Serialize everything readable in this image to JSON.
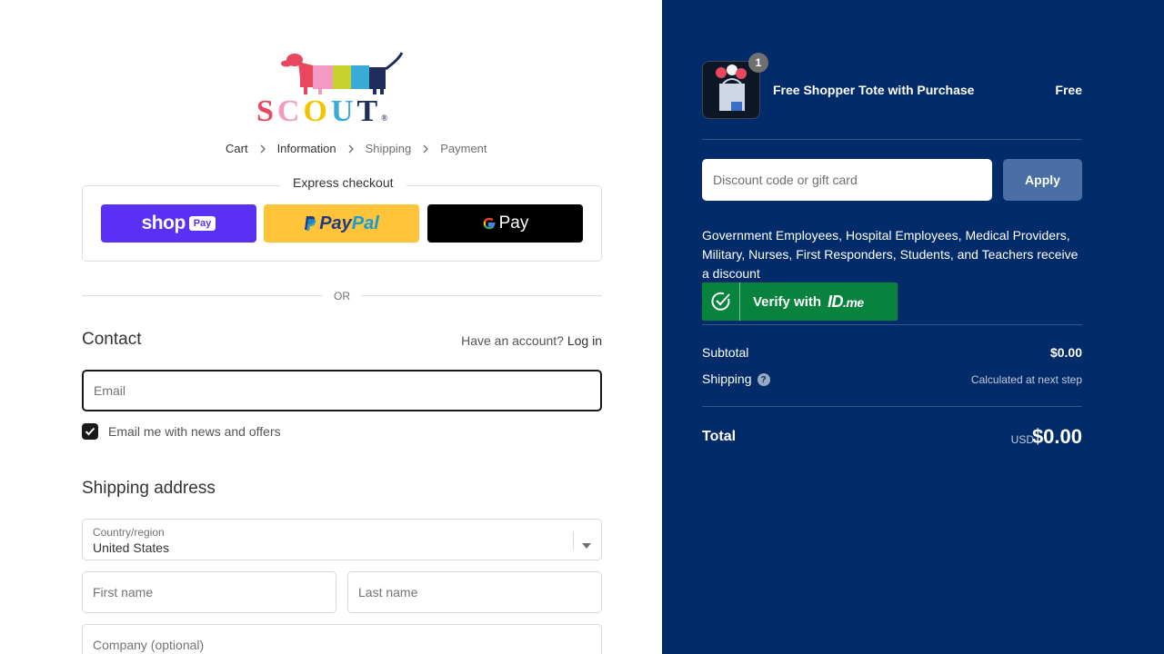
{
  "brand": {
    "logo_text": "SCOUT",
    "logo_colors": [
      "#e8475f",
      "#f49ac1",
      "#f5c400",
      "#3aaad6",
      "#1f2d5c"
    ],
    "logo_mark": "®"
  },
  "breadcrumb": {
    "items": [
      {
        "label": "Cart",
        "state": "link"
      },
      {
        "label": "Information",
        "state": "active"
      },
      {
        "label": "Shipping",
        "state": "inactive"
      },
      {
        "label": "Payment",
        "state": "inactive"
      }
    ]
  },
  "express_checkout": {
    "title": "Express checkout",
    "shop_pay": {
      "label_shop": "shop",
      "label_pay": "Pay",
      "color": "#5a31f4"
    },
    "paypal": {
      "label_pay": "Pay",
      "label_pal": "Pal",
      "color": "#ffc439"
    },
    "gpay": {
      "label": "Pay",
      "color": "#000000"
    }
  },
  "divider_or": "OR",
  "contact": {
    "title": "Contact",
    "have_account": "Have an account?",
    "login_link": "Log in",
    "email_placeholder": "Email",
    "email_value": "",
    "newsletter_label": "Email me with news and offers",
    "newsletter_checked": true
  },
  "shipping_address": {
    "title": "Shipping address",
    "country_label": "Country/region",
    "country_value": "United States",
    "first_name_placeholder": "First name",
    "last_name_placeholder": "Last name",
    "company_placeholder": "Company (optional)"
  },
  "summary": {
    "background": "#022b6a",
    "product": {
      "name": "Free Shopper Tote with Purchase",
      "price": "Free",
      "quantity": "1"
    },
    "discount": {
      "placeholder": "Discount code or gift card",
      "value": "",
      "apply_label": "Apply"
    },
    "idme": {
      "description": "Government Employees, Hospital Employees, Medical Providers, Military, Nurses, First Responders, Students, and Teachers receive a discount",
      "button_label": "Verify with",
      "logo_id": "ID",
      "logo_me": ".me",
      "color": "#08833d"
    },
    "subtotal_label": "Subtotal",
    "subtotal_value": "$0.00",
    "shipping_label": "Shipping",
    "shipping_value": "Calculated at next step",
    "help_glyph": "?",
    "total_label": "Total",
    "total_currency": "USD",
    "total_value": "$0.00"
  }
}
